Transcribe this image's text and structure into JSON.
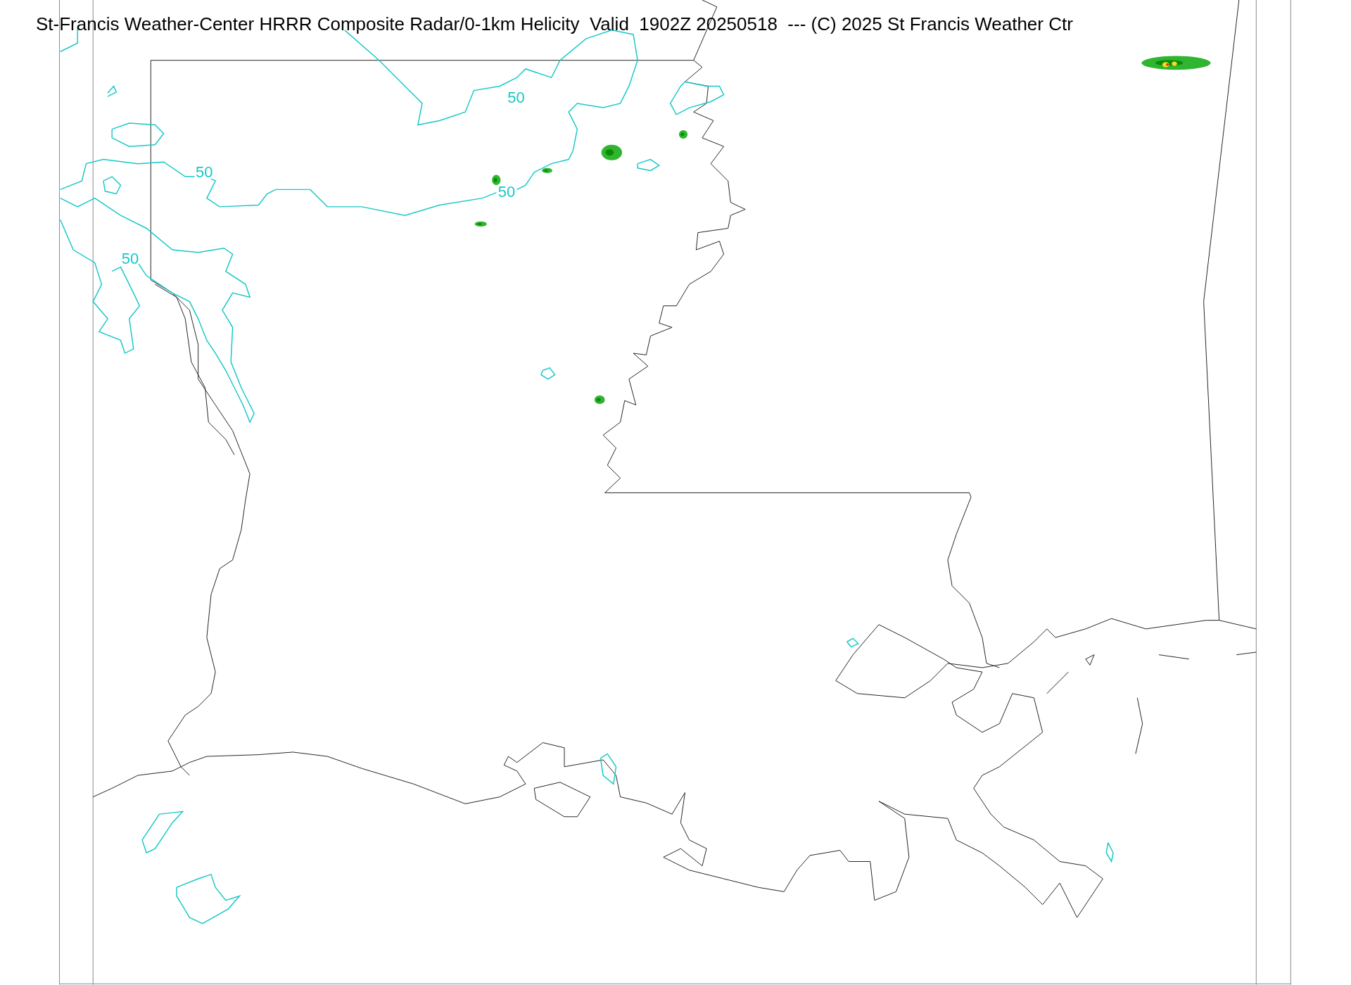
{
  "title": "St-Francis Weather-Center HRRR Composite Radar/0-1km Helicity  Valid  1902Z 20250518  --- (C) 2025 St Francis Weather Ctr",
  "helicity_contour_labels": [
    {
      "label": "50"
    },
    {
      "label": "50"
    },
    {
      "label": "50"
    },
    {
      "label": "50"
    }
  ]
}
